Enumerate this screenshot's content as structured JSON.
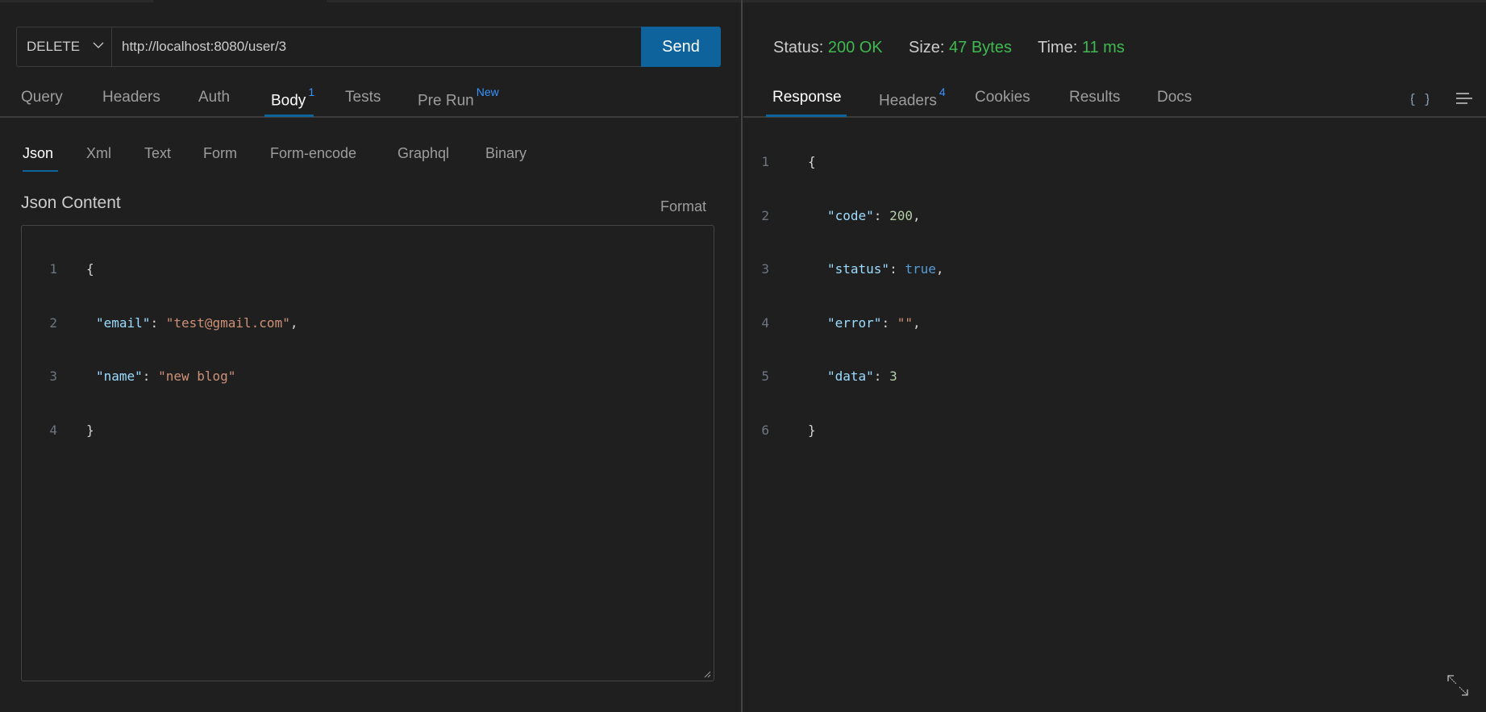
{
  "request": {
    "method": "DELETE",
    "url": "http://localhost:8080/user/3",
    "send_label": "Send",
    "tabs": [
      {
        "label": "Query",
        "badge": ""
      },
      {
        "label": "Headers",
        "badge": ""
      },
      {
        "label": "Auth",
        "badge": ""
      },
      {
        "label": "Body",
        "badge": "1"
      },
      {
        "label": "Tests",
        "badge": ""
      },
      {
        "label": "Pre Run",
        "badge": "New"
      }
    ],
    "active_tab": "Body",
    "body_types": [
      "Json",
      "Xml",
      "Text",
      "Form",
      "Form-encode",
      "Graphql",
      "Binary"
    ],
    "active_body_type": "Json",
    "content_label": "Json Content",
    "format_label": "Format",
    "body_lines": [
      {
        "num": "1",
        "text": "{"
      },
      {
        "num": "2",
        "key": "\"email\"",
        "value": "\"test@gmail.com\"",
        "trail": ","
      },
      {
        "num": "3",
        "key": "\"name\"",
        "value": "\"new blog\"",
        "trail": ""
      },
      {
        "num": "4",
        "text": "}"
      }
    ]
  },
  "response": {
    "status_label": "Status:",
    "status_value": "200 OK",
    "size_label": "Size:",
    "size_value": "47 Bytes",
    "time_label": "Time:",
    "time_value": "11 ms",
    "tabs": [
      {
        "label": "Response",
        "badge": ""
      },
      {
        "label": "Headers",
        "badge": "4"
      },
      {
        "label": "Cookies",
        "badge": ""
      },
      {
        "label": "Results",
        "badge": ""
      },
      {
        "label": "Docs",
        "badge": ""
      }
    ],
    "active_tab": "Response",
    "body_lines": [
      {
        "num": "1",
        "text": "{"
      },
      {
        "num": "2",
        "key": "\"code\"",
        "value": "200",
        "type": "number",
        "trail": ","
      },
      {
        "num": "3",
        "key": "\"status\"",
        "value": "true",
        "type": "bool",
        "trail": ","
      },
      {
        "num": "4",
        "key": "\"error\"",
        "value": "\"\"",
        "type": "string",
        "trail": ","
      },
      {
        "num": "5",
        "key": "\"data\"",
        "value": "3",
        "type": "number",
        "trail": ""
      },
      {
        "num": "6",
        "text": "}"
      }
    ],
    "icons": [
      "braces-icon",
      "wrap-lines-icon",
      "expand-icon"
    ]
  },
  "colors": {
    "accent": "#0e639c",
    "success": "#3fb950",
    "badge": "#3794ff",
    "background": "#1f1f1f"
  }
}
